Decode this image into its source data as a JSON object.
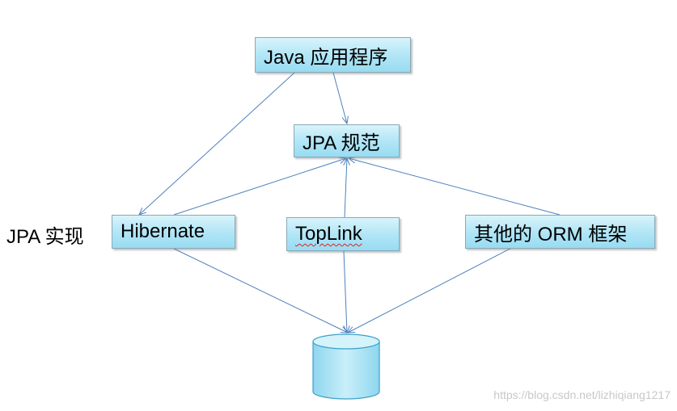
{
  "nodes": {
    "app": "Java 应用程序",
    "spec": "JPA 规范",
    "hibernate": "Hibernate",
    "toplink": "TopLink",
    "orm": "其他的 ORM 框架"
  },
  "side_label": "JPA 实现",
  "watermark": "https://blog.csdn.net/lizhiqiang1217",
  "colors": {
    "box_fill_top": "#d9f4fb",
    "box_fill_bottom": "#98dcf2",
    "arrow": "#4f81bd",
    "database": "#b2e6f6"
  },
  "edges": [
    {
      "from": "app",
      "to": "spec"
    },
    {
      "from": "app",
      "to": "hibernate"
    },
    {
      "from": "hibernate",
      "to": "spec"
    },
    {
      "from": "toplink",
      "to": "spec"
    },
    {
      "from": "orm",
      "to": "spec"
    },
    {
      "from": "hibernate",
      "to": "database"
    },
    {
      "from": "toplink",
      "to": "database"
    },
    {
      "from": "orm",
      "to": "database"
    }
  ]
}
